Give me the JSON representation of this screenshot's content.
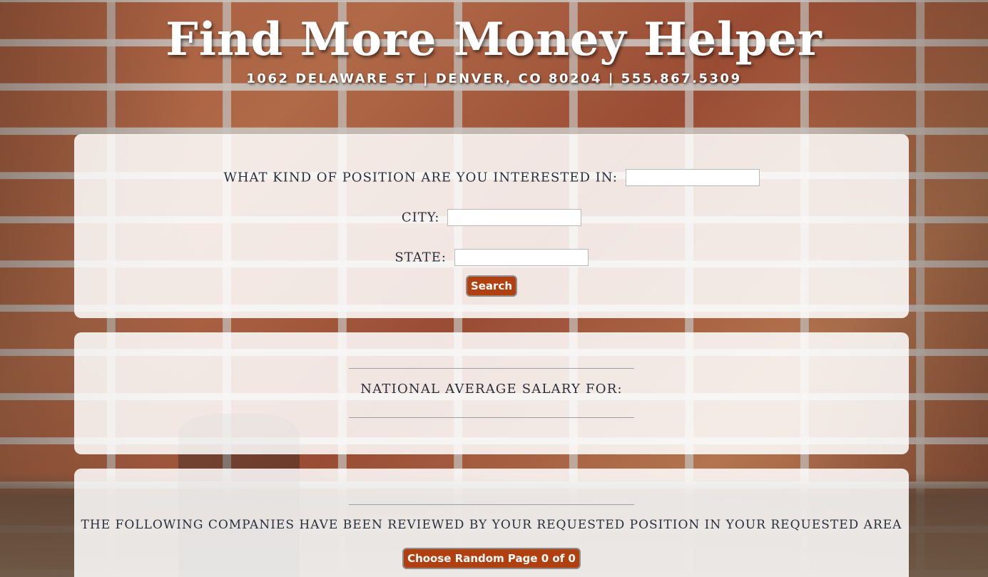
{
  "header": {
    "title": "Find More Money Helper",
    "address": "1062 DELAWARE ST | DENVER, CO 80204 | 555.867.5309"
  },
  "search_form": {
    "position_label": "WHAT KIND OF POSITION ARE YOU INTERESTED IN:",
    "position_value": "",
    "city_label": "CITY:",
    "city_value": "",
    "state_label": "STATE:",
    "state_value": "",
    "search_button": "Search"
  },
  "average_salary": {
    "title": "NATIONAL AVERAGE SALARY FOR:"
  },
  "companies": {
    "title": "THE FOLLOWING COMPANIES HAVE BEEN REVIEWED BY YOUR REQUESTED POSITION IN YOUR REQUESTED AREA",
    "random_button": "Choose Random Page 0 of 0"
  },
  "colors": {
    "button_bg": "#b2400f",
    "panel_bg": "rgba(255,255,255,0.86)",
    "text": "#2a2e3a"
  }
}
